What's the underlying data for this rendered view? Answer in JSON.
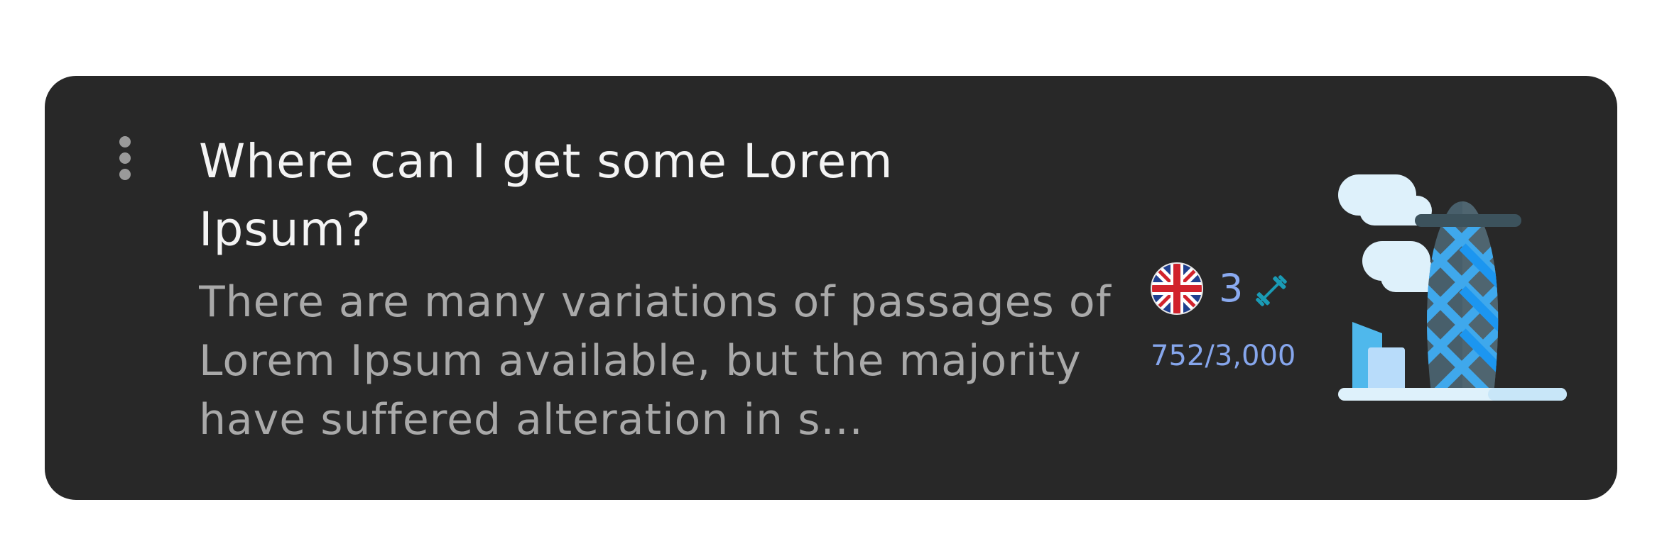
{
  "card": {
    "title": "Where can I get some Lorem Ipsum?",
    "description": "There are many variations of passages of Lorem Ipsum available, but the majority have suffered alteration in s...",
    "language_flag_icon": "uk-flag-icon",
    "level_count": "3",
    "level_icon": "dumbbell-icon",
    "progress_text": "752/3,000",
    "progress_fraction": 0.2507,
    "illustration_icon": "gherkin-building-illustration",
    "menu_icon": "vertical-dots-icon"
  },
  "colors": {
    "card_background": "#282828",
    "title": "#f4f4f4",
    "description": "#a9a9a9",
    "accent_blue": "#8aaaf0",
    "dumbbell_teal": "#1a9bb5"
  }
}
